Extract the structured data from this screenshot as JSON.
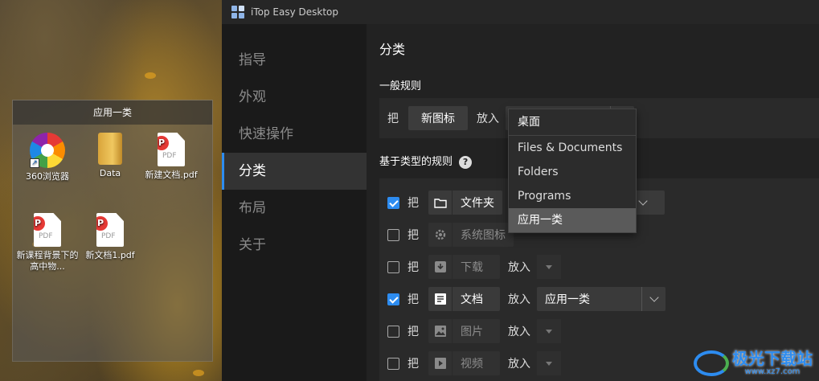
{
  "desktop": {
    "fence_title": "应用一类",
    "icons": [
      {
        "label": "360浏览器",
        "icon": "browser-360-icon"
      },
      {
        "label": "Data",
        "icon": "folder-icon"
      },
      {
        "label": "新建文档.pdf",
        "icon": "pdf-icon"
      },
      {
        "label": "新课程背景下的高中物...",
        "icon": "pdf-icon"
      },
      {
        "label": "新文档1.pdf",
        "icon": "pdf-icon"
      }
    ],
    "pdf_text": "PDF",
    "pdf_badge": "P",
    "shortcut_glyph": "↗"
  },
  "window": {
    "title": "iTop Easy Desktop"
  },
  "sidebar": {
    "items": [
      {
        "label": "指导",
        "active": false
      },
      {
        "label": "外观",
        "active": false
      },
      {
        "label": "快速操作",
        "active": false
      },
      {
        "label": "分类",
        "active": true
      },
      {
        "label": "布局",
        "active": false
      },
      {
        "label": "关于",
        "active": false
      }
    ]
  },
  "main": {
    "title": "分类",
    "general_heading": "一般规则",
    "general_rule": {
      "prefix": "把",
      "button": "新图标",
      "put_into": "放入",
      "target": "桌面"
    },
    "type_heading": "基于类型的规则",
    "help_glyph": "?",
    "rules": [
      {
        "checked": true,
        "prefix": "把",
        "type": "文件夹",
        "icon": "folder-outline-icon",
        "put_into": "",
        "target": "",
        "enabled": true
      },
      {
        "checked": false,
        "prefix": "把",
        "type": "系统图标",
        "icon": "gear-icon",
        "put_into": "",
        "target": "",
        "enabled": false
      },
      {
        "checked": false,
        "prefix": "把",
        "type": "下载",
        "icon": "download-icon",
        "put_into": "放入",
        "target": "",
        "enabled": false
      },
      {
        "checked": true,
        "prefix": "把",
        "type": "文档",
        "icon": "document-icon",
        "put_into": "放入",
        "target": "应用一类",
        "enabled": true
      },
      {
        "checked": false,
        "prefix": "把",
        "type": "图片",
        "icon": "image-icon",
        "put_into": "放入",
        "target": "",
        "enabled": false
      },
      {
        "checked": false,
        "prefix": "把",
        "type": "视频",
        "icon": "video-icon",
        "put_into": "放入",
        "target": "",
        "enabled": false
      }
    ],
    "dropdown": {
      "options": [
        "桌面",
        "Files & Documents",
        "Folders",
        "Programs",
        "应用一类"
      ],
      "highlighted_index": 4
    }
  },
  "watermark": {
    "text": "极光下载站",
    "sub": "www.xz7.com"
  },
  "colors": {
    "accent": "#2d8cf0",
    "panel": "#2a2a2a",
    "window_bg": "#1f1f1f"
  }
}
